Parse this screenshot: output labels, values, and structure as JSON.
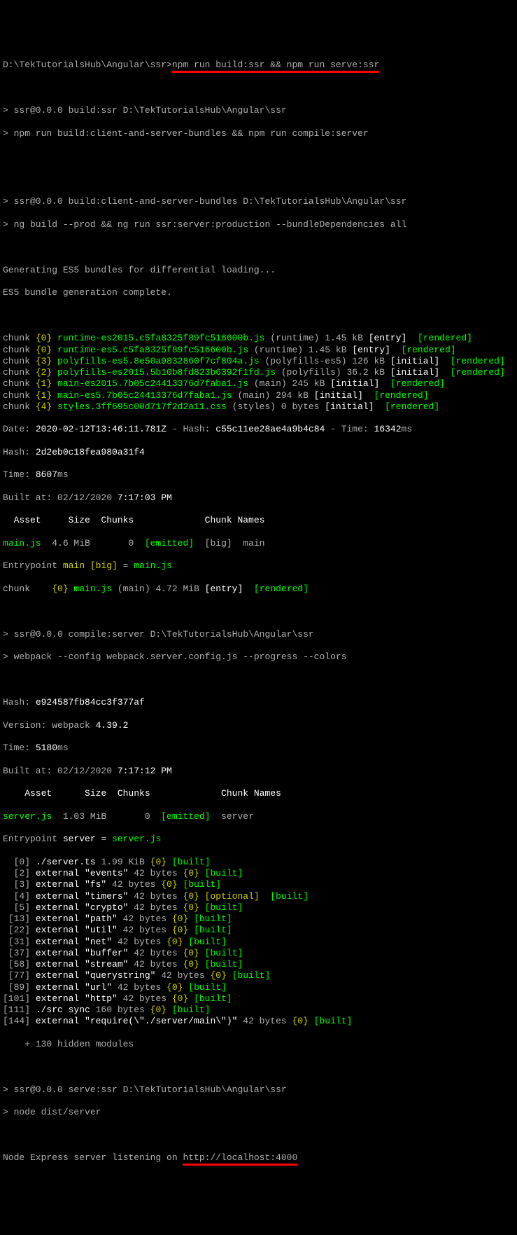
{
  "prompt": {
    "path": "D:\\TekTutorialsHub\\Angular\\ssr>",
    "cmd": "npm run build:ssr && npm run serve:ssr"
  },
  "s1": {
    "l1a": "> ssr@0.0.0 build:ssr D:\\TekTutorialsHub\\Angular\\ssr",
    "l1b": "> npm run build:client-and-server-bundles && npm run compile:server"
  },
  "s2": {
    "l1": "> ssr@0.0.0 build:client-and-server-bundles D:\\TekTutorialsHub\\Angular\\ssr",
    "l2": "> ng build --prod && ng run ssr:server:production --bundleDependencies all"
  },
  "gen": {
    "l1": "Generating ES5 bundles for differential loading...",
    "l2": "ES5 bundle generation complete."
  },
  "chunks": [
    {
      "pre": "chunk ",
      "num": "{0}",
      "file": " runtime-es2015.c5fa8325f89fc516600b.js",
      "meta": " (runtime) 1.45 kB ",
      "tag1": "[entry]",
      "sp": "  ",
      "tag2": "[rendered]"
    },
    {
      "pre": "chunk ",
      "num": "{0}",
      "file": " runtime-es5.c5fa8325f89fc516600b.js",
      "meta": " (runtime) 1.45 kB ",
      "tag1": "[entry]",
      "sp": "  ",
      "tag2": "[rendered]"
    },
    {
      "pre": "chunk ",
      "num": "{3}",
      "file": " polyfills-es5.8e50a9832860f7cf804a.js",
      "meta": " (polyfills-es5) 126 kB ",
      "tag1": "[initial]",
      "sp": "  ",
      "tag2": "[rendered]"
    },
    {
      "pre": "chunk ",
      "num": "{2}",
      "file": " polyfills-es2015.5b10b8fd823b6392f1fd.js",
      "meta": " (polyfills) 36.2 kB ",
      "tag1": "[initial]",
      "sp": "  ",
      "tag2": "[rendered]"
    },
    {
      "pre": "chunk ",
      "num": "{1}",
      "file": " main-es2015.7b05c24413376d7faba1.js",
      "meta": " (main) 245 kB ",
      "tag1": "[initial]",
      "sp": "  ",
      "tag2": "[rendered]"
    },
    {
      "pre": "chunk ",
      "num": "{1}",
      "file": " main-es5.7b05c24413376d7faba1.js",
      "meta": " (main) 294 kB ",
      "tag1": "[initial]",
      "sp": "  ",
      "tag2": "[rendered]"
    },
    {
      "pre": "chunk ",
      "num": "{4}",
      "file": " styles.3ff695c00d717f2d2a11.css",
      "meta": " (styles) 0 bytes ",
      "tag1": "[initial]",
      "sp": "  ",
      "tag2": "[rendered]"
    }
  ],
  "date": {
    "label": "Date: ",
    "ts": "2020-02-12T13:46:11.781Z",
    "hashlbl": " - Hash: ",
    "hash": "c55c11ee28ae4a9b4c84",
    "timelbl": " - Time: ",
    "time": "16342",
    "ms": "ms"
  },
  "hash": {
    "label": "Hash: ",
    "val": "2d2eb0c18fea980a31f4"
  },
  "time": {
    "label": "Time: ",
    "val": "8607",
    "ms": "ms"
  },
  "built": {
    "label": "Built at: 02/12/2020 ",
    "val": "7:17:03 PM"
  },
  "tableHeader": "  Asset     Size  Chunks             Chunk Names",
  "mainjs": {
    "name": "main.js",
    "size": "  4.6 MiB       0  ",
    "emitted": "[emitted]",
    "big": "  [big]  ",
    "chname": "main"
  },
  "entry": {
    "p1": "Entrypoint ",
    "p2": "main",
    " p3": " [big] = ",
    "p4": "main.js"
  },
  "chunk2": {
    "pre": "chunk    ",
    "num": "{0}",
    "file": " main.js",
    "meta": " (main) 4.72 MiB ",
    "tag1": "[entry]",
    "sp": "  ",
    "tag2": "[rendered]"
  },
  "compile": {
    "l1": "> ssr@0.0.0 compile:server D:\\TekTutorialsHub\\Angular\\ssr",
    "l2": "> webpack --config webpack.server.config.js --progress --colors"
  },
  "hash2": {
    "label": "Hash: ",
    "val": "e924587fb84cc3f377af"
  },
  "ver": {
    "label": "Version: webpack ",
    "val": "4.39.2"
  },
  "time2": {
    "label": "Time: ",
    "val": "5180",
    "ms": "ms"
  },
  "built2": {
    "label": "Built at: 02/12/2020 ",
    "val": "7:17:12 PM"
  },
  "tableHeader2": "    Asset      Size  Chunks             Chunk Names",
  "serverjs": {
    "name": "server.js",
    "size": "  1.03 MiB       0  ",
    "emitted": "[emitted]",
    "chname": "  server"
  },
  "entry2": {
    "p1": "Entrypoint ",
    "p2": "server",
    "p3": " = ",
    "p4": "server.js"
  },
  "mods": [
    {
      "txt": "  [0] ",
      "f": "./server.ts",
      "sz": " 1.99 KiB ",
      "n": "{0}",
      "sp": " ",
      "b": "[built]"
    },
    {
      "txt": "  [2] ",
      "f": "external \"events\"",
      "sz": " 42 bytes ",
      "n": "{0}",
      "sp": " ",
      "b": "[built]"
    },
    {
      "txt": "  [3] ",
      "f": "external \"fs\"",
      "sz": " 42 bytes ",
      "n": "{0}",
      "sp": " ",
      "b": "[built]"
    },
    {
      "txt": "  [4] ",
      "f": "external \"timers\"",
      "sz": " 42 bytes ",
      "n": "{0}",
      "sp": " ",
      "opt": "[optional]",
      "sp2": "  ",
      "b": "[built]"
    },
    {
      "txt": "  [5] ",
      "f": "external \"crypto\"",
      "sz": " 42 bytes ",
      "n": "{0}",
      "sp": " ",
      "b": "[built]"
    },
    {
      "txt": " [13] ",
      "f": "external \"path\"",
      "sz": " 42 bytes ",
      "n": "{0}",
      "sp": " ",
      "b": "[built]"
    },
    {
      "txt": " [22] ",
      "f": "external \"util\"",
      "sz": " 42 bytes ",
      "n": "{0}",
      "sp": " ",
      "b": "[built]"
    },
    {
      "txt": " [31] ",
      "f": "external \"net\"",
      "sz": " 42 bytes ",
      "n": "{0}",
      "sp": " ",
      "b": "[built]"
    },
    {
      "txt": " [37] ",
      "f": "external \"buffer\"",
      "sz": " 42 bytes ",
      "n": "{0}",
      "sp": " ",
      "b": "[built]"
    },
    {
      "txt": " [58] ",
      "f": "external \"stream\"",
      "sz": " 42 bytes ",
      "n": "{0}",
      "sp": " ",
      "b": "[built]"
    },
    {
      "txt": " [77] ",
      "f": "external \"querystring\"",
      "sz": " 42 bytes ",
      "n": "{0}",
      "sp": " ",
      "b": "[built]"
    },
    {
      "txt": " [89] ",
      "f": "external \"url\"",
      "sz": " 42 bytes ",
      "n": "{0}",
      "sp": " ",
      "b": "[built]"
    },
    {
      "txt": "[101] ",
      "f": "external \"http\"",
      "sz": " 42 bytes ",
      "n": "{0}",
      "sp": " ",
      "b": "[built]"
    },
    {
      "txt": "[111] ",
      "f": "./src sync",
      "sz": " 160 bytes ",
      "n": "{0}",
      "sp": " ",
      "b": "[built]"
    },
    {
      "txt": "[144] ",
      "f": "external \"require(\\\"./server/main\\\")\"",
      "sz": " 42 bytes ",
      "n": "{0}",
      "sp": " ",
      "b": "[built]"
    }
  ],
  "hidden": "    + 130 hidden modules",
  "serve": {
    "l1": "> ssr@0.0.0 serve:ssr D:\\TekTutorialsHub\\Angular\\ssr",
    "l2": "> node dist/server"
  },
  "final": {
    "p1": "Node Express server listening on ",
    "p2": "http://localhost:4000"
  }
}
